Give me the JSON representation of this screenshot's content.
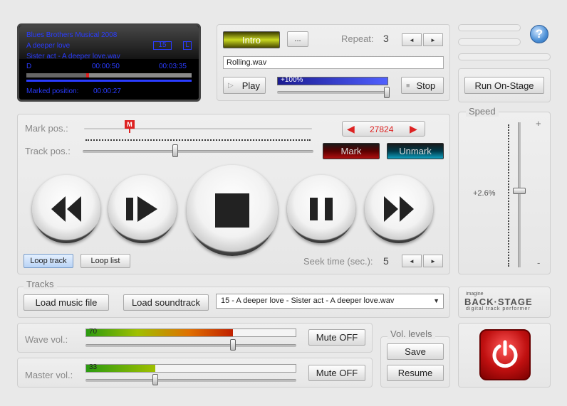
{
  "lcd": {
    "line1": "Blues Brothers Musical 2008",
    "line2": "A deeper love",
    "badge_num": "15",
    "badge_l": "L",
    "line3": "Sister act - A deeper love.wav",
    "time_prefix": "D",
    "time_elapsed": "00:00:50",
    "time_total": "00:03:35",
    "progress": 0.37,
    "marked_label": "Marked position:",
    "marked_value": "00:00:27"
  },
  "intro": {
    "intro_label": "Intro",
    "ellipsis_label": "...",
    "repeat_label": "Repeat:",
    "repeat_value": "3",
    "filename": "Rolling.wav",
    "play_label": "Play",
    "volume_text": "+100%",
    "volume_level": 1.0,
    "stop_label": "Stop"
  },
  "help": {
    "icon_text": "?"
  },
  "onstage": {
    "run_label": "Run On-Stage"
  },
  "position": {
    "mark_pos_label": "Mark pos.:",
    "marker_letter": "M",
    "counter_value": "27824",
    "track_pos_label": "Track pos.:",
    "mark_label": "Mark",
    "unmark_label": "Unmark",
    "loop_track_label": "Loop track",
    "loop_list_label": "Loop list",
    "seek_label": "Seek time (sec.):",
    "seek_value": "5"
  },
  "speed": {
    "legend": "Speed",
    "plus": "+",
    "minus": "-",
    "value": "+2.6%"
  },
  "tracks": {
    "legend": "Tracks",
    "load_music_label": "Load music file",
    "load_soundtrack_label": "Load soundtrack",
    "selected": "15 - A deeper love - Sister act - A deeper love.wav"
  },
  "logo": {
    "small": "imagine",
    "main": "BACK·STAGE",
    "tagline": "digital track performer"
  },
  "wave": {
    "label": "Wave vol.:",
    "meter_value": "70",
    "level": 0.7,
    "mute_label": "Mute OFF"
  },
  "master": {
    "label": "Master vol.:",
    "meter_value": "33",
    "level": 0.33,
    "mute_label": "Mute OFF"
  },
  "vol_levels": {
    "legend": "Vol. levels",
    "save_label": "Save",
    "resume_label": "Resume"
  }
}
